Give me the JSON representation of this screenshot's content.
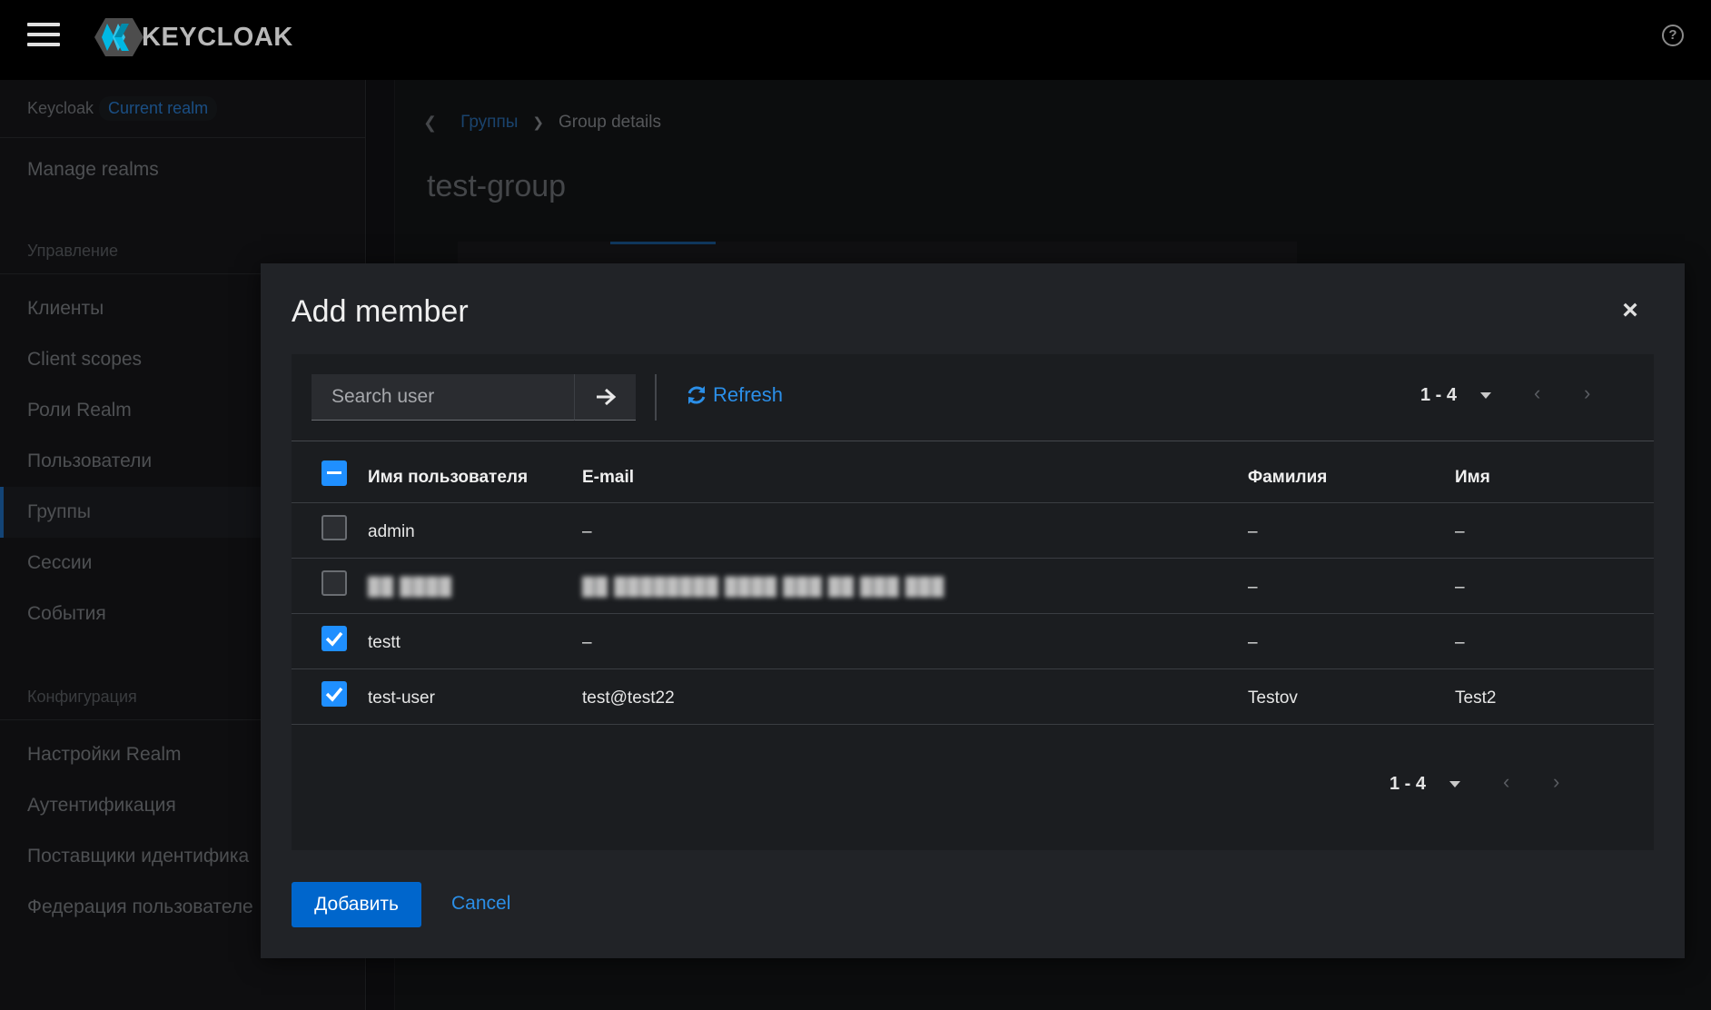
{
  "masthead": {
    "brand": "KEYCLOAK",
    "help_icon": "help-circle-icon"
  },
  "sidebar": {
    "realm_name": "Keycloak",
    "realm_badge": "Current realm",
    "manage_realms": "Manage realms",
    "section_manage": "Управление",
    "manage_items": [
      {
        "label": "Клиенты"
      },
      {
        "label": "Client scopes"
      },
      {
        "label": "Роли Realm"
      },
      {
        "label": "Пользователи"
      },
      {
        "label": "Группы",
        "active": true
      },
      {
        "label": "Сессии"
      },
      {
        "label": "События"
      }
    ],
    "section_config": "Конфигурация",
    "config_items": [
      {
        "label": "Настройки Realm"
      },
      {
        "label": "Аутентификация"
      },
      {
        "label": "Поставщики идентифика"
      },
      {
        "label": "Федерация пользователе"
      }
    ]
  },
  "page": {
    "breadcrumb_link": "Группы",
    "breadcrumb_current": "Group details",
    "title": "test-group"
  },
  "modal": {
    "title": "Add member",
    "search_placeholder": "Search user",
    "refresh_label": "Refresh",
    "pager_top": "1 - 4",
    "pager_bottom": "1 - 4",
    "columns": {
      "username": "Имя пользователя",
      "email": "E-mail",
      "last_name": "Фамилия",
      "first_name": "Имя"
    },
    "rows": [
      {
        "username": "admin",
        "email": "–",
        "last_name": "–",
        "first_name": "–",
        "checked": false
      },
      {
        "username": "██ ████",
        "email": "██ ████████ ████ ███ ██ ███ ███",
        "last_name": "–",
        "first_name": "–",
        "checked": false,
        "redacted": true
      },
      {
        "username": "testt",
        "email": "–",
        "last_name": "–",
        "first_name": "–",
        "checked": true
      },
      {
        "username": "test-user",
        "email": "test@test22",
        "last_name": "Testov",
        "first_name": "Test2",
        "checked": true
      }
    ],
    "add_label": "Добавить",
    "cancel_label": "Cancel"
  },
  "colors": {
    "accent": "#0066cc",
    "link": "#2b8fe8",
    "masthead": "#000000"
  }
}
